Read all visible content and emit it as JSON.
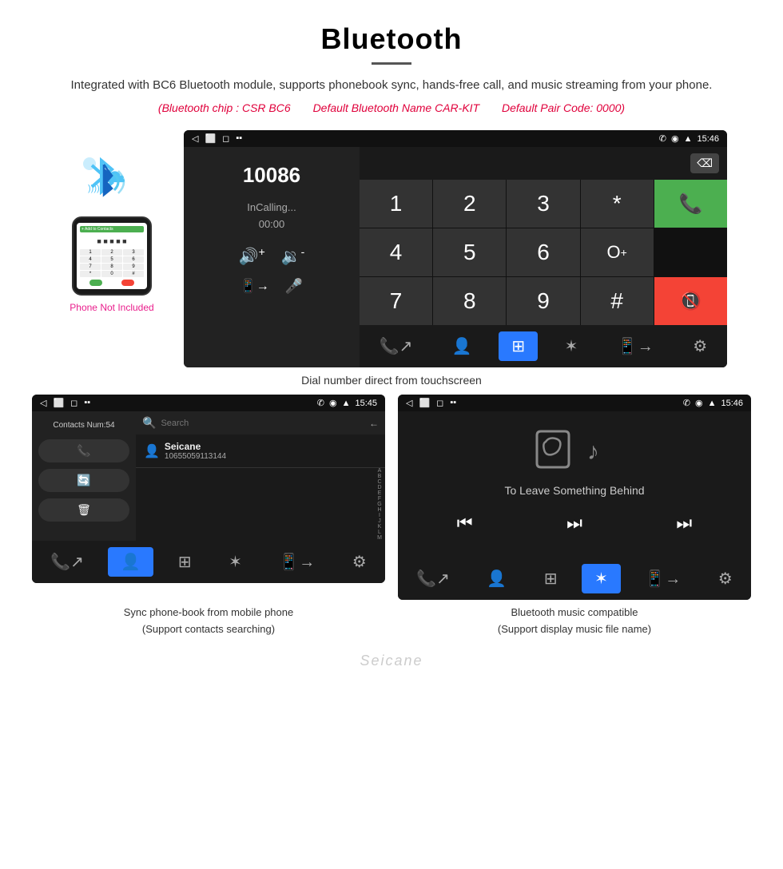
{
  "page": {
    "title": "Bluetooth",
    "divider": true,
    "description": "Integrated with BC6 Bluetooth module, supports phonebook sync, hands-free call, and music streaming from your phone.",
    "specs": {
      "chip": "(Bluetooth chip : CSR BC6",
      "name": "Default Bluetooth Name CAR-KIT",
      "code": "Default Pair Code: 0000)"
    }
  },
  "main_screen": {
    "statusbar": {
      "left": [
        "◁",
        "⬜",
        "□"
      ],
      "right_icons": [
        "✆",
        "◉",
        "▲",
        "15:46"
      ]
    },
    "dial": {
      "number": "10086",
      "status": "InCalling...",
      "timer": "00:00",
      "vol_up": "🔊+",
      "vol_down": "🔉-",
      "transfer": "📱→",
      "mic": "🎤",
      "keys": [
        "1",
        "2",
        "3",
        "*",
        "4",
        "5",
        "6",
        "0+",
        "7",
        "8",
        "9",
        "#"
      ]
    },
    "caption": "Dial number direct from touchscreen"
  },
  "phone_aside": {
    "not_included": "Phone Not Included"
  },
  "contacts_screen": {
    "statusbar_time": "15:45",
    "contacts_num_label": "Contacts Num:54",
    "search_placeholder": "Search",
    "contact": {
      "name": "Seicane",
      "number": "10655059113144"
    },
    "alpha": [
      "A",
      "B",
      "C",
      "D",
      "E",
      "F",
      "G",
      "H",
      "I",
      "J",
      "K",
      "L",
      "M"
    ],
    "bottom_caption": "Sync phone-book from mobile phone\n(Support contacts searching)"
  },
  "music_screen": {
    "statusbar_time": "15:46",
    "song_title": "To Leave Something Behind",
    "bottom_caption": "Bluetooth music compatible\n(Support display music file name)"
  },
  "bottom_nav_items": [
    "✆↗",
    "👤",
    "⊞",
    "✶",
    "📱→",
    "⚙"
  ],
  "watermark": "Seicane"
}
